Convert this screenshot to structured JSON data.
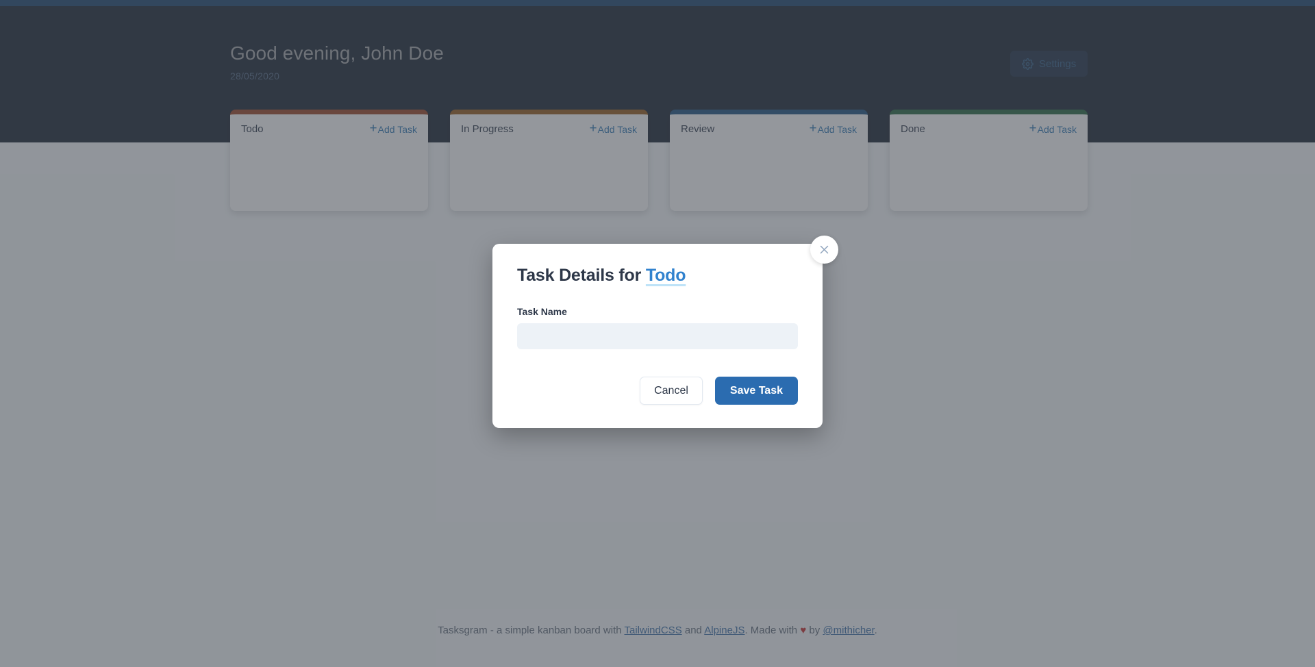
{
  "app": {
    "accent_strip_color": "#17406b",
    "header_bg": "#15202f",
    "page_bg": "#f7fafc"
  },
  "header": {
    "greeting": "Good evening, John Doe",
    "date": "28/05/2020",
    "settings_label": "Settings",
    "settings_icon": "gear-icon"
  },
  "board": {
    "add_task_label": "Add Task",
    "plus_icon": "plus-icon",
    "columns": [
      {
        "title": "Todo",
        "accent": "#9c4221"
      },
      {
        "title": "In Progress",
        "accent": "#975a16"
      },
      {
        "title": "Review",
        "accent": "#1a4f7e"
      },
      {
        "title": "Done",
        "accent": "#22643c"
      }
    ]
  },
  "modal": {
    "title_prefix": "Task Details for",
    "title_link": "Todo",
    "close_icon": "close-icon",
    "field_label": "Task Name",
    "field_value": "",
    "field_placeholder": "",
    "cancel_label": "Cancel",
    "save_label": "Save Task",
    "save_color": "#2b6cb0"
  },
  "footer": {
    "text_before": "Tasksgram - a simple kanban board with ",
    "link1": "TailwindCSS",
    "text_mid1": " and ",
    "link2": "AlpineJS",
    "text_mid2": ". Made with ",
    "heart": "♥",
    "text_mid3": " by ",
    "link3": "@mithicher",
    "text_after": "."
  }
}
